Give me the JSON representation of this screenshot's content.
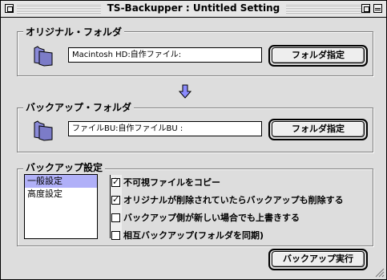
{
  "window": {
    "title": "TS-Backupper : Untitled Setting"
  },
  "original": {
    "label": "オリジナル・フォルダ",
    "path": "Macintosh HD:自作ファイル:",
    "button": "フォルダ指定"
  },
  "backup": {
    "label": "バックアップ・フォルダ",
    "path": "ファイルBU:自作ファイルBU :",
    "button": "フォルダ指定"
  },
  "settings": {
    "label": "バックアップ設定",
    "list": [
      "一般設定",
      "高度設定"
    ],
    "selected_index": 0,
    "options": [
      {
        "label": "不可視ファイルをコピー",
        "checked": true
      },
      {
        "label": "オリジナルが削除されていたらバックアップも削除する",
        "checked": true
      },
      {
        "label": "バックアップ側が新しい場合でも上書きする",
        "checked": false
      },
      {
        "label": "相互バックアップ(フォルダを同期)",
        "checked": false
      }
    ]
  },
  "run_button": "バックアップ実行",
  "colors": {
    "accent_arrow": "#8c8cff",
    "folder": "#8a8ad8",
    "selection": "#b0b0f8"
  }
}
